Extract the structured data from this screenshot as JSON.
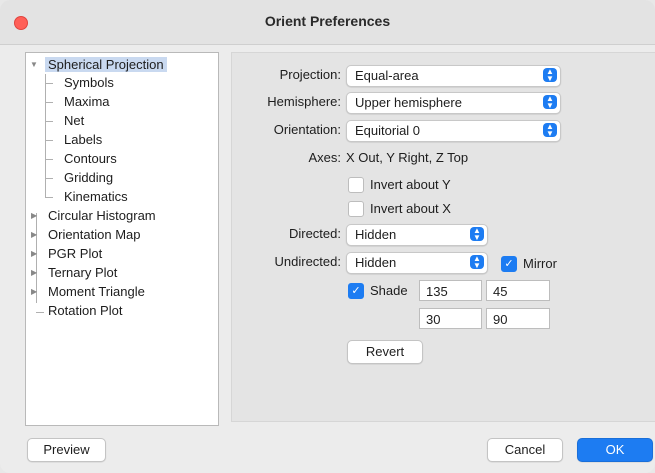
{
  "window": {
    "title": "Orient Preferences"
  },
  "tree": {
    "root": "Spherical Projection",
    "children": [
      "Symbols",
      "Maxima",
      "Net",
      "Labels",
      "Contours",
      "Gridding",
      "Kinematics"
    ],
    "others": [
      "Circular Histogram",
      "Orientation Map",
      "PGR Plot",
      "Ternary Plot",
      "Moment Triangle",
      "Rotation Plot"
    ]
  },
  "form": {
    "projection_label": "Projection:",
    "projection_value": "Equal-area",
    "hemisphere_label": "Hemisphere:",
    "hemisphere_value": "Upper hemisphere",
    "orientation_label": "Orientation:",
    "orientation_value": "Equitorial 0",
    "axes_label": "Axes:",
    "axes_value": "X Out, Y Right, Z Top",
    "invert_y_label": "Invert about Y",
    "invert_x_label": "Invert about X",
    "directed_label": "Directed:",
    "directed_value": "Hidden",
    "undirected_label": "Undirected:",
    "undirected_value": "Hidden",
    "mirror_label": "Mirror",
    "shade_label": "Shade",
    "shade_values": [
      "135",
      "45",
      "30",
      "90"
    ],
    "revert_label": "Revert"
  },
  "footer": {
    "preview_label": "Preview",
    "cancel_label": "Cancel",
    "ok_label": "OK"
  }
}
